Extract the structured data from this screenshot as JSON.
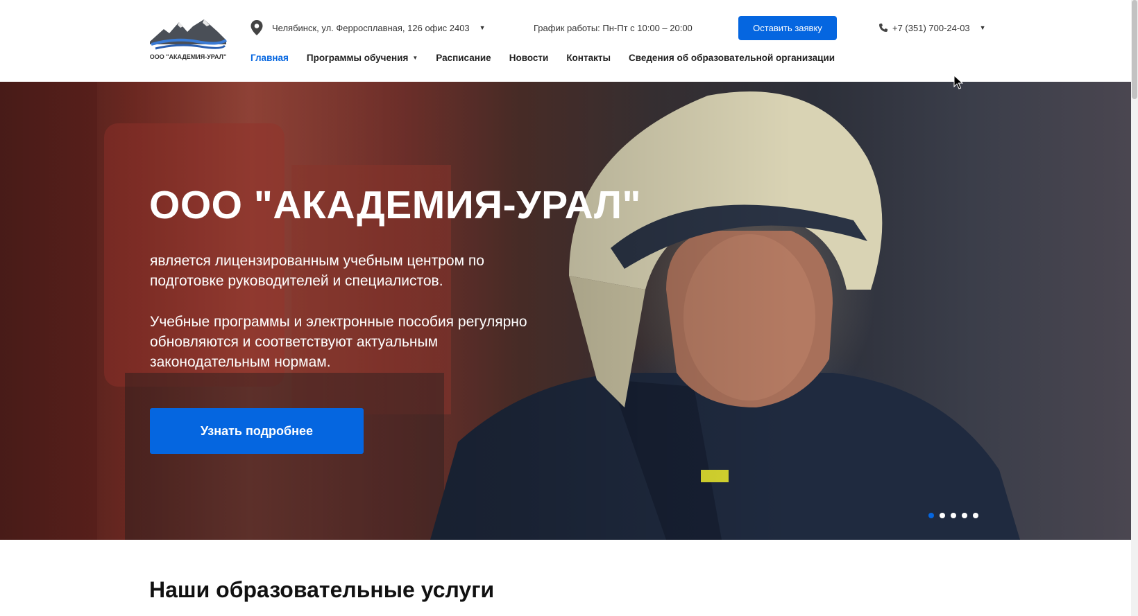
{
  "header": {
    "logo_text": "ООО \"АКАДЕМИЯ-УРАЛ\"",
    "address": "Челябинск, ул. Ферросплавная, 126 офис 2403",
    "hours": "График работы: Пн-Пт с 10:00 – 20:00",
    "cta_label": "Оставить заявку",
    "phone": "+7 (351) 700-24-03",
    "accent_color": "#0566e0"
  },
  "nav": {
    "items": [
      {
        "label": "Главная"
      },
      {
        "label": "Программы обучения"
      },
      {
        "label": "Расписание"
      },
      {
        "label": "Новости"
      },
      {
        "label": "Контакты"
      },
      {
        "label": "Сведения об образовательной организации"
      }
    ]
  },
  "hero": {
    "title": "ООО \"АКАДЕМИЯ-УРАЛ\"",
    "paragraph1": "является лицензированным учебным центром по подготовке руководителей и специалистов.",
    "paragraph2": "Учебные программы и электронные пособия регулярно обновляются и соответствуют актуальным законодательным нормам.",
    "button_label": "Узнать подробнее",
    "slides_count": 5,
    "active_slide": 1
  },
  "section": {
    "title": "Наши образовательные услуги"
  }
}
